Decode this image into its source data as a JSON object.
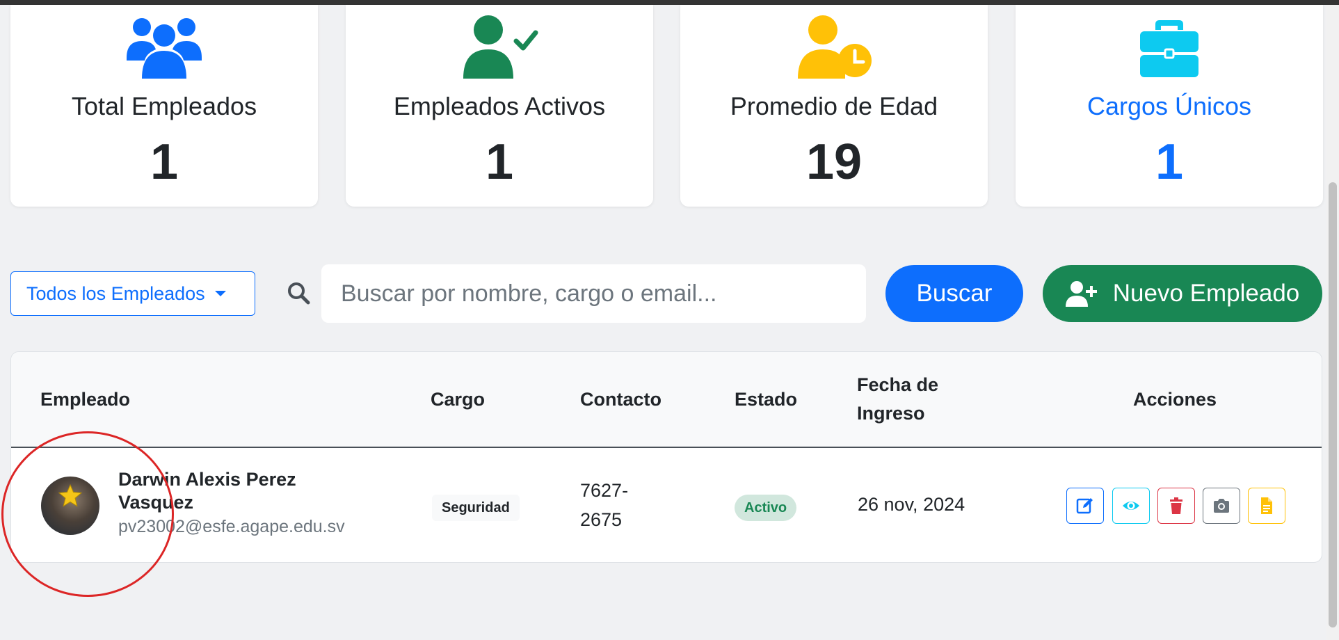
{
  "stats": [
    {
      "label": "Total Empleados",
      "value": "1",
      "icon": "users-icon",
      "color": "#0d6efd"
    },
    {
      "label": "Empleados Activos",
      "value": "1",
      "icon": "user-check-icon",
      "color": "#198754"
    },
    {
      "label": "Promedio de Edad",
      "value": "19",
      "icon": "user-clock-icon",
      "color": "#ffc107"
    },
    {
      "label": "Cargos Únicos",
      "value": "1",
      "icon": "briefcase-icon",
      "color": "#0dcaf0"
    }
  ],
  "toolbar": {
    "filter_label": "Todos los Empleados",
    "search_placeholder": "Buscar por nombre, cargo o email...",
    "search_button": "Buscar",
    "new_button": "Nuevo Empleado"
  },
  "table": {
    "headers": {
      "empleado": "Empleado",
      "cargo": "Cargo",
      "contacto": "Contacto",
      "estado": "Estado",
      "fecha_line1": "Fecha de",
      "fecha_line2": "Ingreso",
      "acciones": "Acciones"
    },
    "rows": [
      {
        "name": "Darwin Alexis Perez Vasquez",
        "email": "pv23002@esfe.agape.edu.sv",
        "cargo": "Seguridad",
        "contacto": "7627-2675",
        "estado": "Activo",
        "fecha": "26 nov, 2024"
      }
    ],
    "actions": [
      {
        "name": "edit-icon",
        "color": "#0d6efd"
      },
      {
        "name": "eye-icon",
        "color": "#0dcaf0"
      },
      {
        "name": "trash-icon",
        "color": "#dc3545"
      },
      {
        "name": "camera-icon",
        "color": "#6c757d"
      },
      {
        "name": "file-icon",
        "color": "#ffc107"
      }
    ]
  },
  "annotation_color": "#dc2626"
}
